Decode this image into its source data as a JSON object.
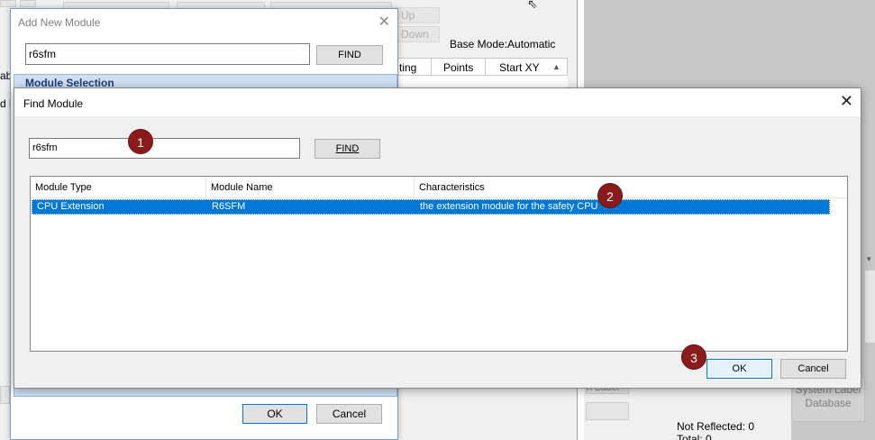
{
  "background": {
    "btn_up": "Up",
    "btn_down": "Down",
    "base_mode": "Base Mode:Automatic",
    "col_setting": "ting",
    "col_points": "Points",
    "col_start_xy": "Start XY",
    "left_text_1": "ab",
    "left_text_2": "d b",
    "system_label_db": "System Label Database",
    "reflected_label": "Not Reflected: 0",
    "total_label": "Total: 0",
    "partial_label": "n Label"
  },
  "add_module_dialog": {
    "title": "Add New Module",
    "search_value": "r6sfm",
    "find_label": "FIND",
    "section_label": "Module Selection",
    "ok_label": "OK",
    "cancel_label": "Cancel",
    "close_glyph": "✕"
  },
  "find_module_dialog": {
    "title": "Find Module",
    "close_glyph": "✕",
    "search_value": "r6sfm",
    "find_label": "FIND",
    "columns": [
      "Module Type",
      "Module Name",
      "Characteristics"
    ],
    "rows": [
      {
        "module_type": "CPU Extension",
        "module_name": "R6SFM",
        "characteristics": "the extension module for the safety CPU"
      }
    ],
    "ok_label": "OK",
    "cancel_label": "Cancel"
  },
  "markers": [
    "1",
    "2",
    "3"
  ],
  "colors": {
    "selection": "#0078d7",
    "marker": "#8b1a1a",
    "section_bg": "#cfe0f3"
  }
}
